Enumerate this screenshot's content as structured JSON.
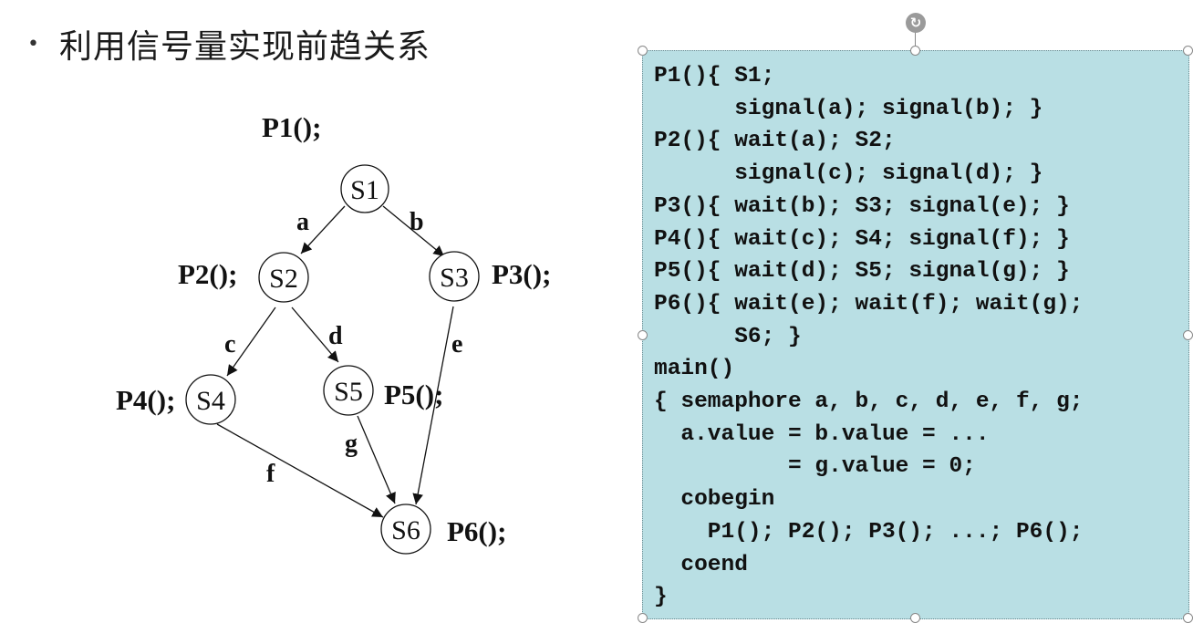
{
  "slide": {
    "bullet": "•",
    "title": "利用信号量实现前趋关系"
  },
  "graph": {
    "nodes": [
      {
        "id": "S1",
        "label": "S1",
        "process": "P1();"
      },
      {
        "id": "S2",
        "label": "S2",
        "process": "P2();"
      },
      {
        "id": "S3",
        "label": "S3",
        "process": "P3();"
      },
      {
        "id": "S4",
        "label": "S4",
        "process": "P4();"
      },
      {
        "id": "S5",
        "label": "S5",
        "process": "P5();"
      },
      {
        "id": "S6",
        "label": "S6",
        "process": "P6();"
      }
    ],
    "edges": [
      {
        "from": "S1",
        "to": "S2",
        "label": "a"
      },
      {
        "from": "S1",
        "to": "S3",
        "label": "b"
      },
      {
        "from": "S2",
        "to": "S4",
        "label": "c"
      },
      {
        "from": "S2",
        "to": "S5",
        "label": "d"
      },
      {
        "from": "S3",
        "to": "S6",
        "label": "e"
      },
      {
        "from": "S4",
        "to": "S6",
        "label": "f"
      },
      {
        "from": "S5",
        "to": "S6",
        "label": "g"
      }
    ]
  },
  "code": {
    "lines": [
      "P1(){ S1;",
      "      signal(a); signal(b); }",
      "P2(){ wait(a); S2;",
      "      signal(c); signal(d); }",
      "P3(){ wait(b); S3; signal(e); }",
      "P4(){ wait(c); S4; signal(f); }",
      "P5(){ wait(d); S5; signal(g); }",
      "P6(){ wait(e); wait(f); wait(g);",
      "      S6; }",
      "main()",
      "{ semaphore a, b, c, d, e, f, g;",
      "  a.value = b.value = ...",
      "          = g.value = 0;",
      "  cobegin",
      "    P1(); P2(); P3(); ...; P6();",
      "  coend",
      "}"
    ]
  }
}
